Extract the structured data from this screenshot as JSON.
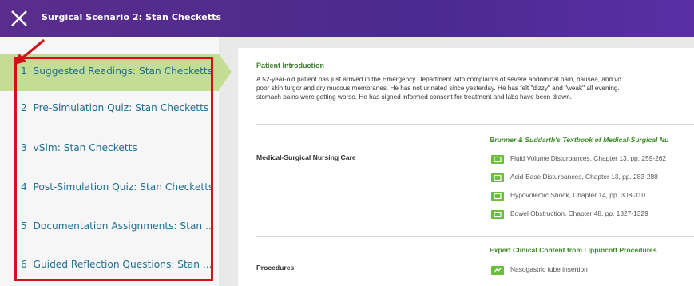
{
  "header": {
    "title": "Surgical Scenario 2: Stan Checketts"
  },
  "sidebar": {
    "items": [
      {
        "num": "1",
        "label": "Suggested Readings: Stan Checketts"
      },
      {
        "num": "2",
        "label": "Pre-Simulation Quiz: Stan Checketts"
      },
      {
        "num": "3",
        "label": "vSim: Stan Checketts"
      },
      {
        "num": "4",
        "label": "Post-Simulation Quiz: Stan Checketts"
      },
      {
        "num": "5",
        "label": "Documentation Assignments: Stan ..."
      },
      {
        "num": "6",
        "label": "Guided Reflection Questions: Stan ..."
      }
    ]
  },
  "main": {
    "intro_title": "Patient Introduction",
    "intro_lines": [
      "A 52-year-old patient has just arrived in the Emergency Department with complaints of severe abdominal pain, nausea, and vo",
      "poor skin turgor and dry mucous membranes. He has not urinated since yesterday. He has felt \"dizzy\" and \"weak\" all evening.",
      "stomach pains were getting worse. He has signed informed consent for treatment and labs have been drawn."
    ],
    "sections": [
      {
        "label": "Medical-Surgical Nursing Care",
        "source": "Brunner & Suddarth's Textbook of Medical-Surgical Nu",
        "links": [
          "Fluid Volume Disturbances, Chapter 13, pp. 259-262",
          "Acid-Base Disturbances, Chapter 13, pp. 283-288",
          "Hypovolemic Shock, Chapter 14, pp. 308-310",
          "Bowel Obstruction, Chapter 48, pp. 1327-1329"
        ]
      },
      {
        "label": "Procedures",
        "source": "Expert Clinical Content from Lippincott Procedures",
        "links": [
          "Nasogastric tube insertion"
        ]
      }
    ]
  },
  "colors": {
    "header_purple": "#4a2a8e",
    "active_green": "#c4dd94",
    "annotation_red": "#d0121b",
    "link_blue": "#1f6e93",
    "section_green": "#3b7a2a"
  }
}
